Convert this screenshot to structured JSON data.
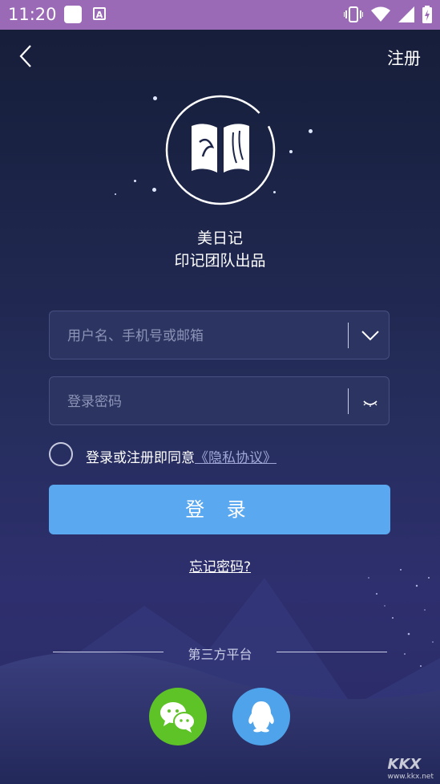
{
  "status_bar": {
    "time": "11:20",
    "icons": [
      "notification-square-icon",
      "app-a-icon",
      "vibrate-icon",
      "wifi-icon",
      "signal-icon",
      "battery-charging-icon"
    ]
  },
  "nav": {
    "back_icon": "chevron-left-icon",
    "register_label": "注册"
  },
  "app": {
    "logo_icon": "open-book-icon",
    "name": "美日记",
    "tagline": "印记团队出品"
  },
  "username": {
    "placeholder": "用户名、手机号或邮箱",
    "value": "",
    "dropdown_icon": "chevron-down-icon"
  },
  "password": {
    "placeholder": "登录密码",
    "value": "",
    "toggle_icon": "eye-closed-icon"
  },
  "agreement": {
    "checked": false,
    "text": "登录或注册即同意",
    "link": "《隐私协议》"
  },
  "login_button": "登 录",
  "forgot_password": "忘记密码?",
  "third_party": {
    "label": "第三方平台",
    "buttons": [
      {
        "name": "wechat",
        "icon": "wechat-icon",
        "color": "#5ec326"
      },
      {
        "name": "qq",
        "icon": "qq-icon",
        "color": "#4ea3ea"
      }
    ]
  },
  "watermark": {
    "brand": "KKX",
    "url": "www.kkx.net"
  },
  "colors": {
    "status_bar": "#9a6ab6",
    "primary_button": "#5aa8f0",
    "background": "#1c2448"
  }
}
